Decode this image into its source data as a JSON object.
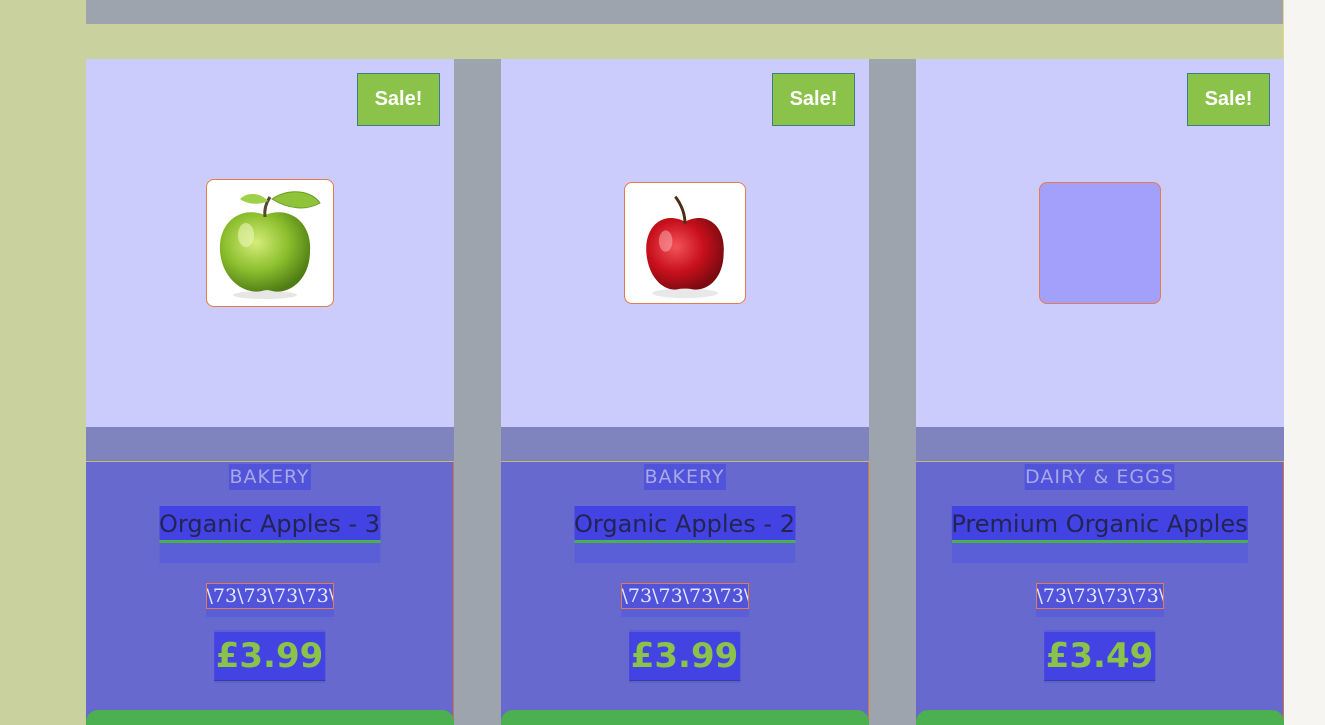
{
  "colors": {
    "sale_badge": "#8bc34a",
    "price_text": "#8bc34a",
    "title_underline": "#4caf50",
    "card_top": "#ccccfc",
    "card_body": "#6869cf",
    "gutter": "#c9d29f"
  },
  "products": [
    {
      "badge": "Sale!",
      "image": "green-apple-image",
      "category": "BAKERY",
      "title": "Organic Apples - 3",
      "code": "\\73\\73\\73\\73\\",
      "price": "£3.99"
    },
    {
      "badge": "Sale!",
      "image": "red-apple-image",
      "category": "BAKERY",
      "title": "Organic Apples - 2",
      "code": "\\73\\73\\73\\73\\",
      "price": "£3.99"
    },
    {
      "badge": "Sale!",
      "image": "image-placeholder",
      "category": "DAIRY & EGGS",
      "title": "Premium Organic Apples",
      "code": "\\73\\73\\73\\73\\",
      "price": "£3.49"
    }
  ]
}
